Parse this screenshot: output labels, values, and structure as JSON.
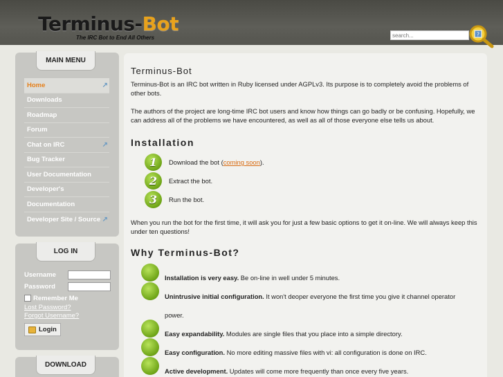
{
  "header": {
    "logo_main": "Terminus-",
    "logo_accent": "Bot",
    "tagline": "The IRC Bot to End All Others",
    "search_placeholder": "search..."
  },
  "sidebar": {
    "menu_title": "MAIN MENU",
    "menu": [
      {
        "label": "Home",
        "arrow": "↗"
      },
      {
        "label": "Downloads",
        "arrow": ""
      },
      {
        "label": "Roadmap",
        "arrow": ""
      },
      {
        "label": "Forum",
        "arrow": ""
      },
      {
        "label": "Chat on IRC",
        "arrow": "↗"
      },
      {
        "label": "Bug Tracker",
        "arrow": ""
      },
      {
        "label": "User Documentation",
        "arrow": ""
      },
      {
        "label": "Developer's",
        "arrow": ""
      },
      {
        "label": "Documentation",
        "arrow": ""
      },
      {
        "label": "Developer Site / Source",
        "arrow": "↗"
      }
    ],
    "login_title": "LOG IN",
    "username_label": "Username",
    "password_label": "Password",
    "remember_label": "Remember Me",
    "lost_password": "Lost Password?",
    "forgot_username": "Forgot Username?",
    "login_button": "Login",
    "download_title": "DOWNLOAD"
  },
  "main": {
    "title": "Terminus-Bot",
    "intro1": "Terminus-Bot is an IRC bot written in Ruby licensed under AGPLv3. Its purpose is to completely avoid the problems of other bots.",
    "intro2": "The authors of the project are long-time IRC bot users and know how things can go badly or be confusing. Hopefully, we can address all of the problems we have encountered, as well as all of those everyone else tells us about.",
    "install_heading": "Installation",
    "steps": [
      {
        "num": "1",
        "text_before": "Download the bot (",
        "link": "coming soon",
        "text_after": ")."
      },
      {
        "num": "2",
        "text": "Extract the bot."
      },
      {
        "num": "3",
        "text": "Run the bot."
      }
    ],
    "run_note": "When you run the bot for the first time,  it will ask you for just a few basic options to get it on-line. We will always keep this under ten questions!",
    "why_heading": "Why Terminus-Bot?",
    "features": [
      {
        "bold": "Installation is very easy.",
        "text": " Be on-line in well under 5 minutes."
      },
      {
        "bold": "Unintrusive initial configuration.",
        "text": " It won't deoper everyone the first time you give it channel operator power."
      },
      {
        "bold": "Easy expandability.",
        "text": " Modules are single files that you place into a simple directory."
      },
      {
        "bold": "Easy configuration.",
        "text": " No more editing massive files with vi: all configuration is done on IRC."
      },
      {
        "bold": "Active development.",
        "text": " Updates will come more frequently than once every five years."
      }
    ]
  }
}
